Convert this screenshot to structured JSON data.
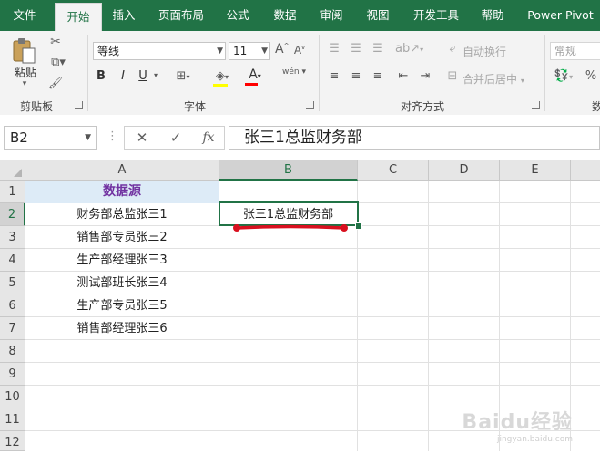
{
  "tabs": [
    "文件",
    "开始",
    "插入",
    "页面布局",
    "公式",
    "数据",
    "审阅",
    "视图",
    "开发工具",
    "帮助",
    "Power Pivot"
  ],
  "active_tab": "开始",
  "ribbon": {
    "clipboard": {
      "paste_label": "粘贴",
      "group_label": "剪贴板"
    },
    "font": {
      "font_name": "等线",
      "font_size": "11",
      "bold": "B",
      "italic": "I",
      "underline": "U",
      "font_color_glyph": "A",
      "increase_font": "A",
      "decrease_font": "A",
      "phonetic_glyph": "wén",
      "group_label": "字体"
    },
    "alignment": {
      "wrap_text_label": "自动换行",
      "merge_center_label": "合并后居中",
      "group_label": "对齐方式"
    },
    "number": {
      "format_value": "常规",
      "percent_glyph": "%",
      "group_label_partial": "数"
    }
  },
  "formula_bar": {
    "name_box": "B2",
    "cancel_glyph": "✕",
    "enter_glyph": "✓",
    "fx_glyph": "fx",
    "content": "张三1总监财务部"
  },
  "columns": [
    "A",
    "B",
    "C",
    "D",
    "E"
  ],
  "rows": [
    "1",
    "2",
    "3",
    "4",
    "5",
    "6",
    "7",
    "8",
    "9",
    "10",
    "11",
    "12"
  ],
  "selected_column": "B",
  "selected_row": "2",
  "cells": {
    "A1": "数据源",
    "A2": "财务部总监张三1",
    "A3": "销售部专员张三2",
    "A4": "生产部经理张三3",
    "A5": "测试部班长张三4",
    "A6": "生产部专员张三5",
    "A7": "销售部经理张三6",
    "B2": "张三1总监财务部"
  },
  "watermark": "Baidu经验",
  "watermark_sub": "jingyan.baidu.com",
  "colors": {
    "excel_green": "#217346",
    "header_fill": "#ddebf7",
    "header_text": "#7030a0",
    "annotation_red": "#d9101f"
  }
}
